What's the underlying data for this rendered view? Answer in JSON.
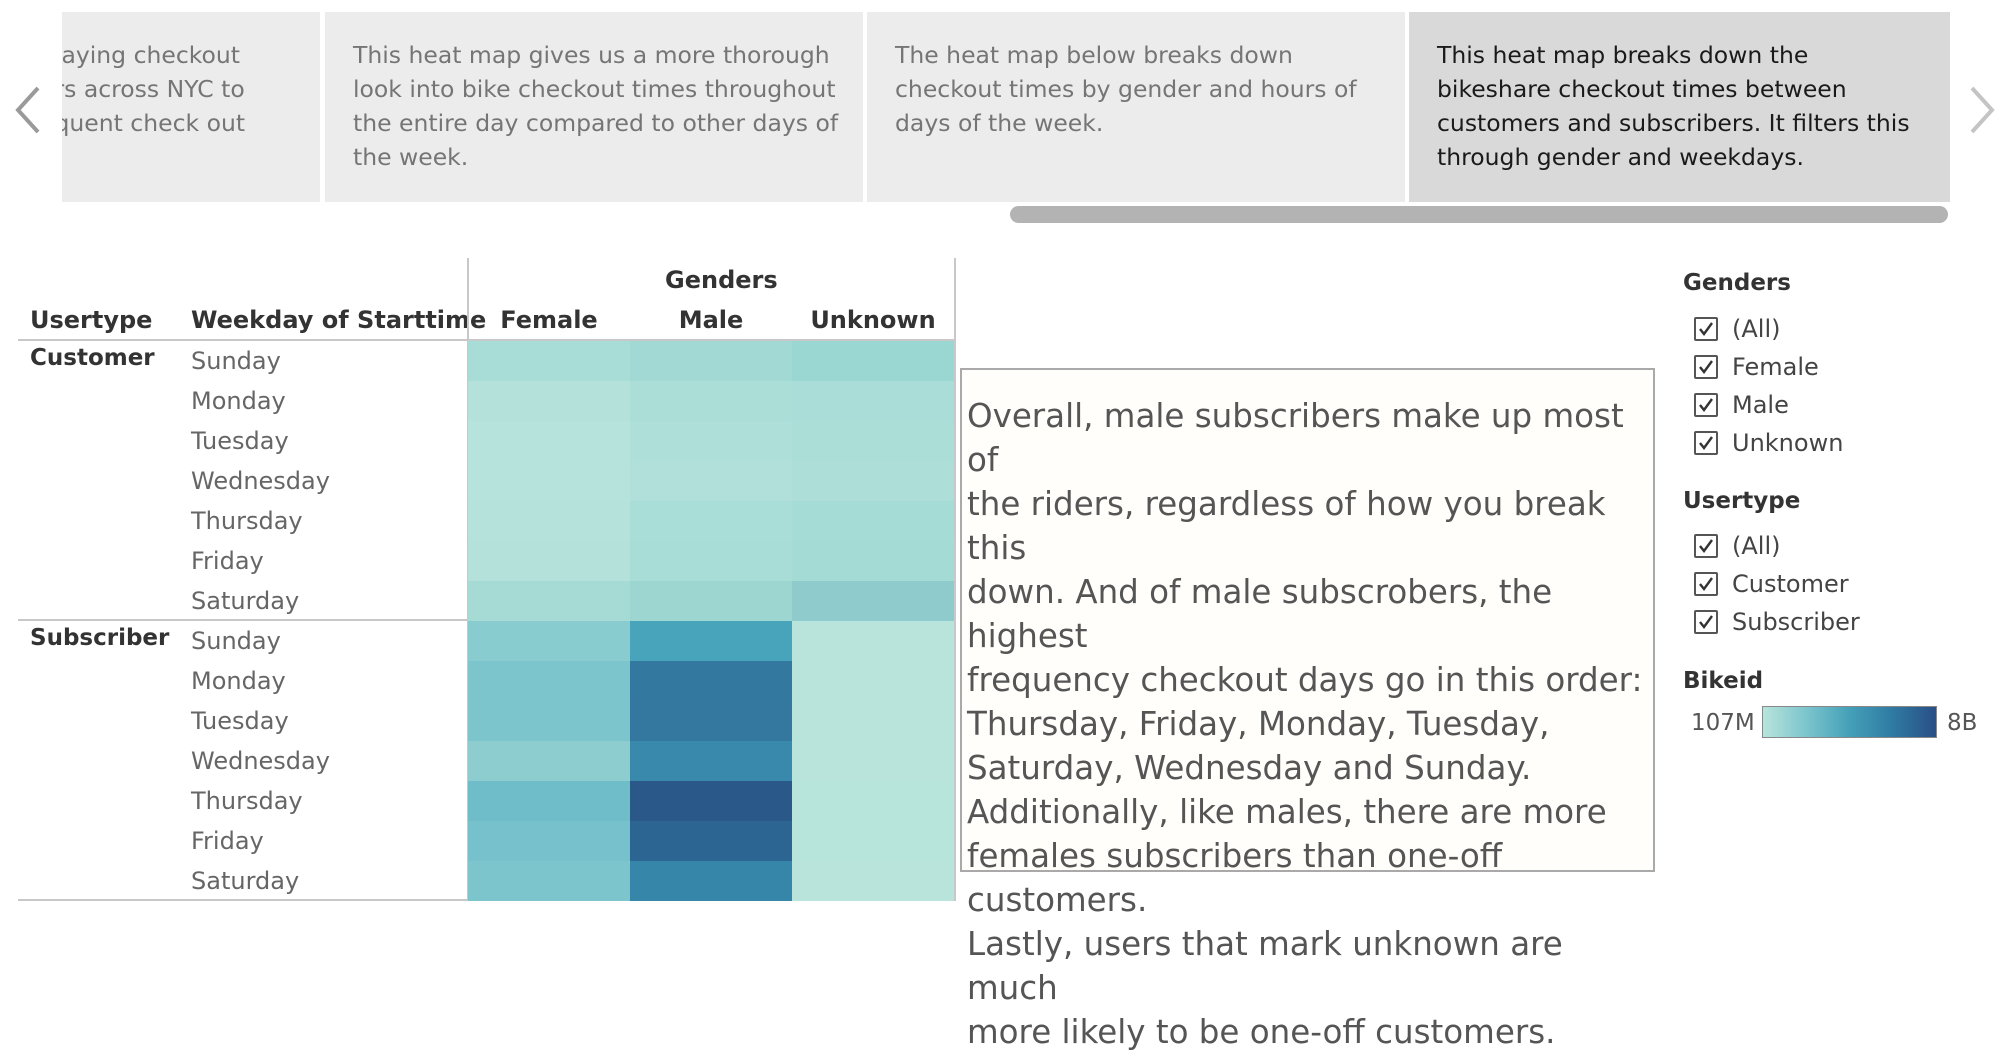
{
  "story_points": [
    {
      "text": "playing checkout\ners across NYC to\nequent check out"
    },
    {
      "text": "This heat map gives us a more thorough look into bike checkout times throughout the entire day compared to other days of the week."
    },
    {
      "text": "The heat map below breaks down checkout times by gender and hours of days of the week."
    },
    {
      "text": "This heat map breaks down the bikeshare checkout times between customers and subscribers. It filters this through gender and weekdays."
    }
  ],
  "navigation": {
    "prev_icon": "chevron-left-icon",
    "next_icon": "chevron-right-icon"
  },
  "heatmap": {
    "column_group_header": "Genders",
    "usertype_header": "Usertype",
    "weekday_header": "Weekday of Starttime",
    "genders": [
      "Female",
      "Male",
      "Unknown"
    ],
    "usertypes": [
      "Customer",
      "Subscriber"
    ],
    "days": [
      "Sunday",
      "Monday",
      "Tuesday",
      "Wednesday",
      "Thursday",
      "Friday",
      "Saturday"
    ],
    "cell_colors": {
      "Customer": [
        [
          "#a8dcd6",
          "#a2d9d4",
          "#9ad6d2"
        ],
        [
          "#b4e2da",
          "#acded8",
          "#aaddd8"
        ],
        [
          "#b6e3db",
          "#aedfd9",
          "#acded8"
        ],
        [
          "#b6e3db",
          "#b0e0d9",
          "#addfd8"
        ],
        [
          "#b5e3db",
          "#a9ddd7",
          "#a6dcd6"
        ],
        [
          "#b4e2da",
          "#a8dcd6",
          "#a5dbd5"
        ],
        [
          "#a6dbd5",
          "#9dd6d1",
          "#8fcbcd"
        ]
      ],
      "Subscriber": [
        [
          "#88ccd0",
          "#48a4bb",
          "#b8e4db"
        ],
        [
          "#7cc5cd",
          "#33789f",
          "#b8e4db"
        ],
        [
          "#7dc5cd",
          "#35789f",
          "#b8e4db"
        ],
        [
          "#8dcdd0",
          "#3889ab",
          "#b8e4db"
        ],
        [
          "#6fbdc9",
          "#2a5889",
          "#b7e4db"
        ],
        [
          "#76c1cb",
          "#2d6592",
          "#b7e4db"
        ],
        [
          "#7cc5cd",
          "#3586a9",
          "#b8e4db"
        ]
      ]
    }
  },
  "annotation": {
    "lines": [
      "Overall, male subscribers make up most of",
      "the riders, regardless of how you break this",
      "down. And of male subscrobers, the highest",
      "frequency checkout days go in this order:",
      "Thursday, Friday, Monday, Tuesday,",
      "Saturday, Wednesday and Sunday.",
      "Additionally, like males, there are more",
      "females subscribers than one-off customers.",
      "Lastly, users that mark unknown are much",
      "more likely to be one-off customers."
    ]
  },
  "filters": {
    "genders": {
      "title": "Genders",
      "options": [
        "(All)",
        "Female",
        "Male",
        "Unknown"
      ],
      "checked": [
        true,
        true,
        true,
        true
      ]
    },
    "usertype": {
      "title": "Usertype",
      "options": [
        "(All)",
        "Customer",
        "Subscriber"
      ],
      "checked": [
        true,
        true,
        true
      ]
    }
  },
  "legend": {
    "title": "Bikeid",
    "min_label": "107M",
    "max_label": "8B",
    "colors": [
      "#b8e4db",
      "#7cc5cd",
      "#44a0b8",
      "#2f7aa3",
      "#2a4f86"
    ]
  }
}
